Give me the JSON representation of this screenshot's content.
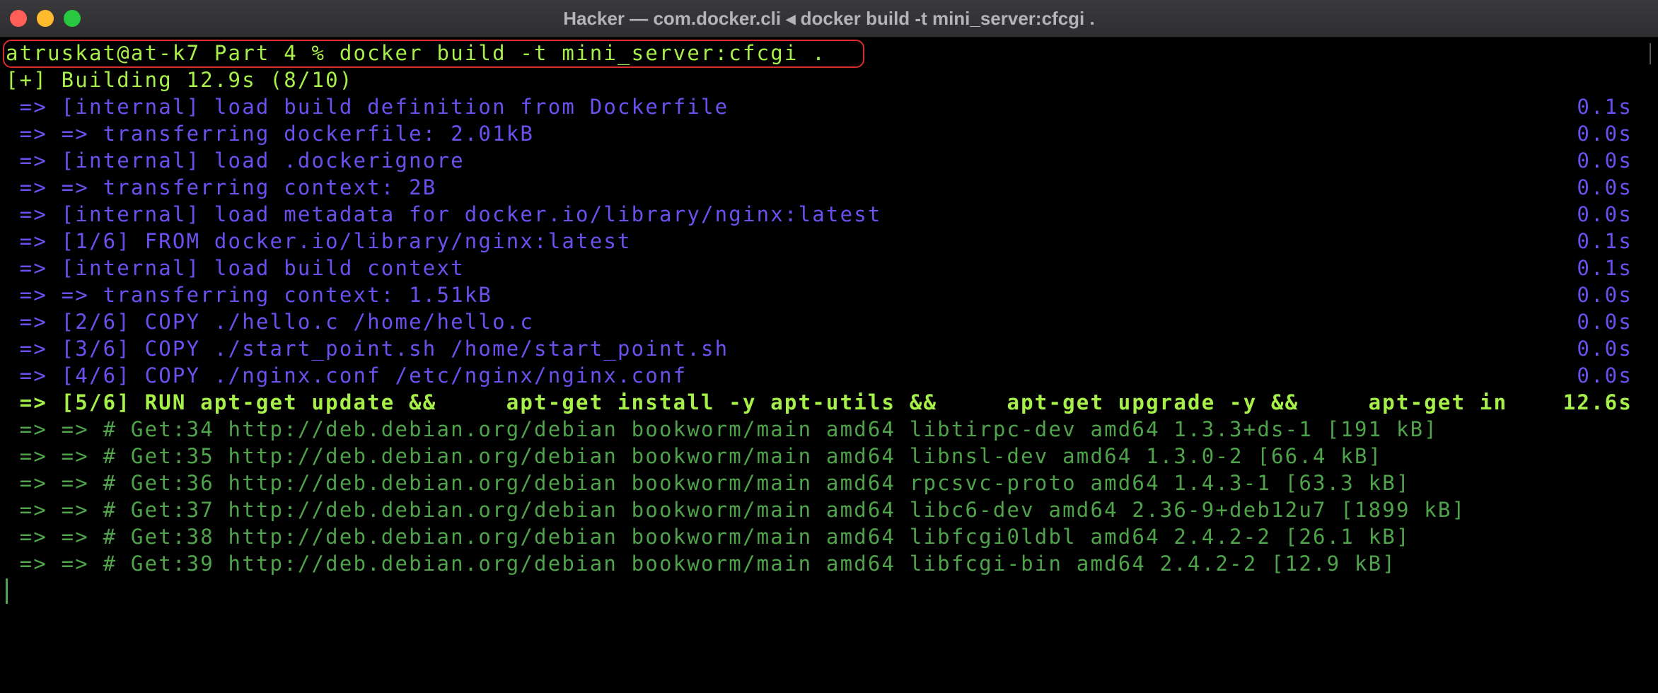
{
  "window": {
    "title": "Hacker — com.docker.cli ◂ docker build -t mini_server:cfcgi ."
  },
  "terminal": {
    "prompt": "atruskat@at-k7 Part 4 % docker build -t mini_server:cfcgi .",
    "building": "[+] Building 12.9s (8/10)",
    "steps": [
      {
        "text": " => [internal] load build definition from Dockerfile",
        "time": "0.1s"
      },
      {
        "text": " => => transferring dockerfile: 2.01kB",
        "time": "0.0s"
      },
      {
        "text": " => [internal] load .dockerignore",
        "time": "0.0s"
      },
      {
        "text": " => => transferring context: 2B",
        "time": "0.0s"
      },
      {
        "text": " => [internal] load metadata for docker.io/library/nginx:latest",
        "time": "0.0s"
      },
      {
        "text": " => [1/6] FROM docker.io/library/nginx:latest",
        "time": "0.1s"
      },
      {
        "text": " => [internal] load build context",
        "time": "0.1s"
      },
      {
        "text": " => => transferring context: 1.51kB",
        "time": "0.0s"
      },
      {
        "text": " => [2/6] COPY ./hello.c /home/hello.c",
        "time": "0.0s"
      },
      {
        "text": " => [3/6] COPY ./start_point.sh /home/start_point.sh",
        "time": "0.0s"
      },
      {
        "text": " => [4/6] COPY ./nginx.conf /etc/nginx/nginx.conf",
        "time": "0.0s"
      }
    ],
    "active_step": {
      "text": " => [5/6] RUN apt-get update &&     apt-get install -y apt-utils &&     apt-get upgrade -y &&     apt-get in",
      "time": "12.6s"
    },
    "log_lines": [
      " => => # Get:34 http://deb.debian.org/debian bookworm/main amd64 libtirpc-dev amd64 1.3.3+ds-1 [191 kB]",
      " => => # Get:35 http://deb.debian.org/debian bookworm/main amd64 libnsl-dev amd64 1.3.0-2 [66.4 kB]",
      " => => # Get:36 http://deb.debian.org/debian bookworm/main amd64 rpcsvc-proto amd64 1.4.3-1 [63.3 kB]",
      " => => # Get:37 http://deb.debian.org/debian bookworm/main amd64 libc6-dev amd64 2.36-9+deb12u7 [1899 kB]",
      " => => # Get:38 http://deb.debian.org/debian bookworm/main amd64 libfcgi0ldbl amd64 2.4.2-2 [26.1 kB]",
      " => => # Get:39 http://deb.debian.org/debian bookworm/main amd64 libfcgi-bin amd64 2.4.2-2 [12.9 kB]"
    ]
  },
  "colors": {
    "prompt_text": "#a7f04a",
    "step_text": "#6d4ff0",
    "log_text": "#4fa34a",
    "highlight_border": "#d92d2d"
  }
}
